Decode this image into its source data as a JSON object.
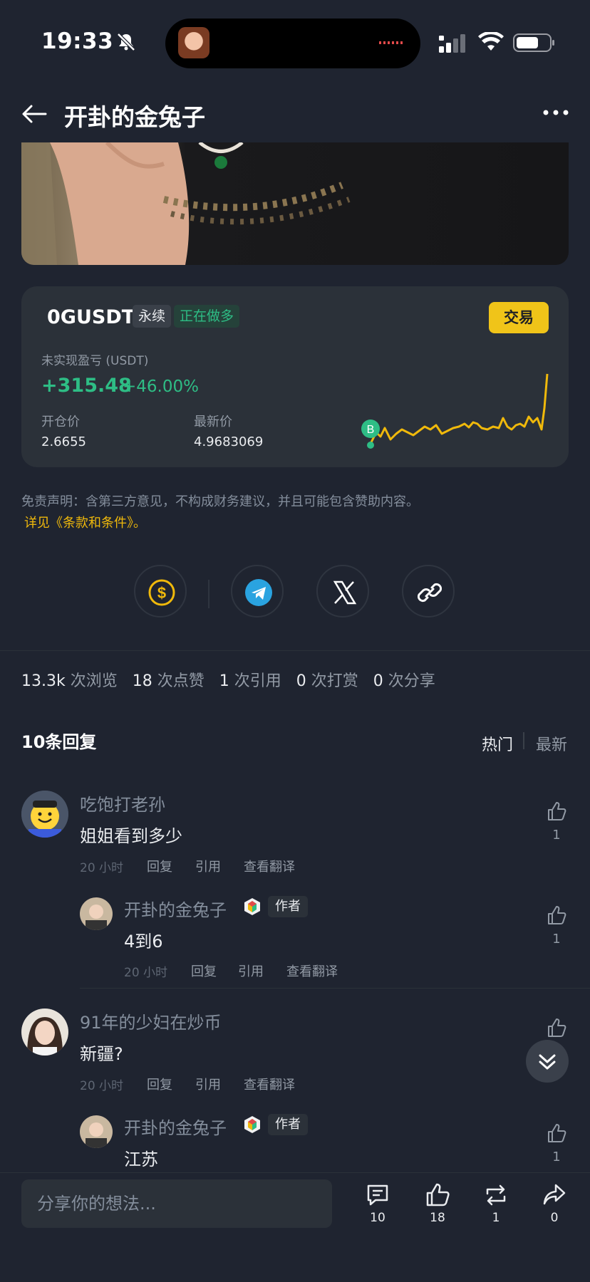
{
  "status": {
    "time": "19:33"
  },
  "header": {
    "title": "开卦的金兔子"
  },
  "trade": {
    "symbol": "0GUSDT",
    "perp_label": "永续",
    "position_label": "正在做多",
    "trade_button": "交易",
    "pnl_label": "未实现盈亏 (USDT)",
    "pnl_value": "+315.48",
    "pnl_pct": "+46.00%",
    "open_label": "开仓价",
    "open_value": "2.6655",
    "last_label": "最新价",
    "last_value": "4.9683069",
    "buy_marker": "B",
    "colors": {
      "profit": "#2ebd85",
      "line": "#f0b90b",
      "accent": "#f0c419"
    }
  },
  "disclaimer": {
    "text": "免责声明：含第三方意见，不构成财务建议，并且可能包含赞助内容。",
    "link": "详见《条款和条件》。"
  },
  "share": {
    "buttons": [
      "tip-icon",
      "telegram-icon",
      "x-icon",
      "link-icon"
    ]
  },
  "stats": [
    {
      "num": "13.3k",
      "label": "次浏览"
    },
    {
      "num": "18",
      "label": "次点赞"
    },
    {
      "num": "1",
      "label": "次引用"
    },
    {
      "num": "0",
      "label": "次打赏"
    },
    {
      "num": "0",
      "label": "次分享"
    }
  ],
  "replies": {
    "title": "10条回复",
    "sort_hot": "热门",
    "sort_new": "最新"
  },
  "comments": [
    {
      "name": "吃饱打老孙",
      "text": "姐姐看到多少",
      "time": "20 小时",
      "reply": "回复",
      "quote": "引用",
      "translate": "查看翻译",
      "likes": "1",
      "sub": {
        "name": "开卦的金兔子",
        "badge": "作者",
        "text": "4到6",
        "time": "20 小时",
        "reply": "回复",
        "quote": "引用",
        "translate": "查看翻译",
        "likes": "1"
      }
    },
    {
      "name": "91年的少妇在炒币",
      "text": "新疆?",
      "time": "20 小时",
      "reply": "回复",
      "quote": "引用",
      "translate": "查看翻译",
      "sub": {
        "name": "开卦的金兔子",
        "badge": "作者",
        "text": "江苏",
        "likes": "1"
      }
    }
  ],
  "bottom": {
    "placeholder": "分享你的想法...",
    "comments": "10",
    "likes": "18",
    "reposts": "1",
    "shares": "0"
  }
}
